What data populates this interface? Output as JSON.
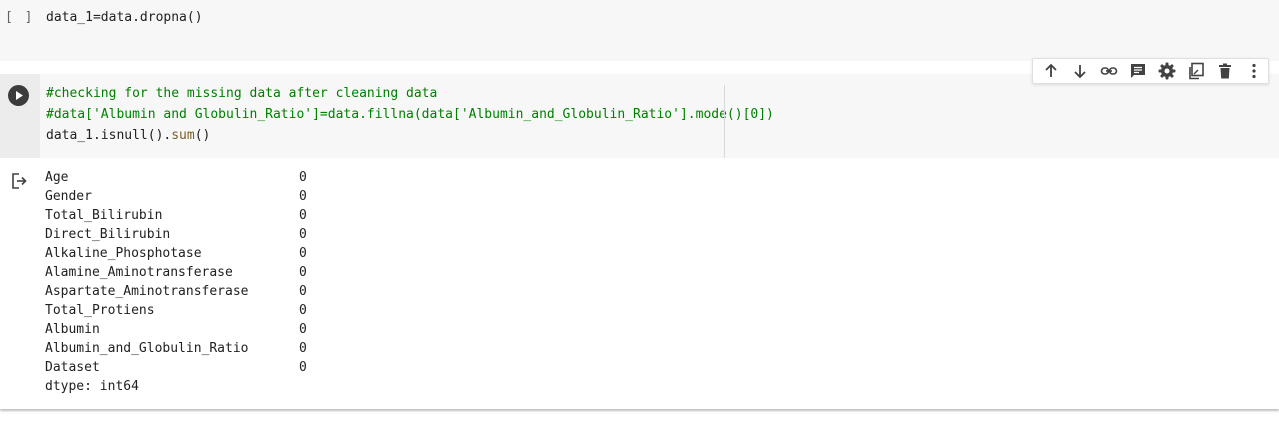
{
  "cell1": {
    "prompt": "[ ]",
    "code": "data_1=data.dropna()"
  },
  "cell2": {
    "line1": "#checking for the missing data after cleaning data",
    "line2": "#data['Albumin and Globulin_Ratio']=data.fillna(data['Albumin_and_Globulin_Ratio'].mode()[0])",
    "line3_prefix": "data_1.isnull().",
    "line3_fn": "sum",
    "line3_suffix": "()"
  },
  "toolbar": {
    "icons": [
      "arrow-up-icon",
      "arrow-down-icon",
      "link-icon",
      "comment-icon",
      "gear-icon",
      "mirror-cell-icon",
      "trash-icon",
      "more-vert-icon"
    ]
  },
  "output": {
    "rows": [
      {
        "name": "Age",
        "value": "0"
      },
      {
        "name": "Gender",
        "value": "0"
      },
      {
        "name": "Total_Bilirubin",
        "value": "0"
      },
      {
        "name": "Direct_Bilirubin",
        "value": "0"
      },
      {
        "name": "Alkaline_Phosphotase",
        "value": "0"
      },
      {
        "name": "Alamine_Aminotransferase",
        "value": "0"
      },
      {
        "name": "Aspartate_Aminotransferase",
        "value": "0"
      },
      {
        "name": "Total_Protiens",
        "value": "0"
      },
      {
        "name": "Albumin",
        "value": "0"
      },
      {
        "name": "Albumin_and_Globulin_Ratio",
        "value": "0"
      },
      {
        "name": "Dataset",
        "value": "0"
      }
    ],
    "dtype": "dtype: int64"
  },
  "colors": {
    "comment": "#008000",
    "function": "#795e26",
    "cell_background": "#f7f7f7",
    "gutter_background": "#ececec"
  }
}
